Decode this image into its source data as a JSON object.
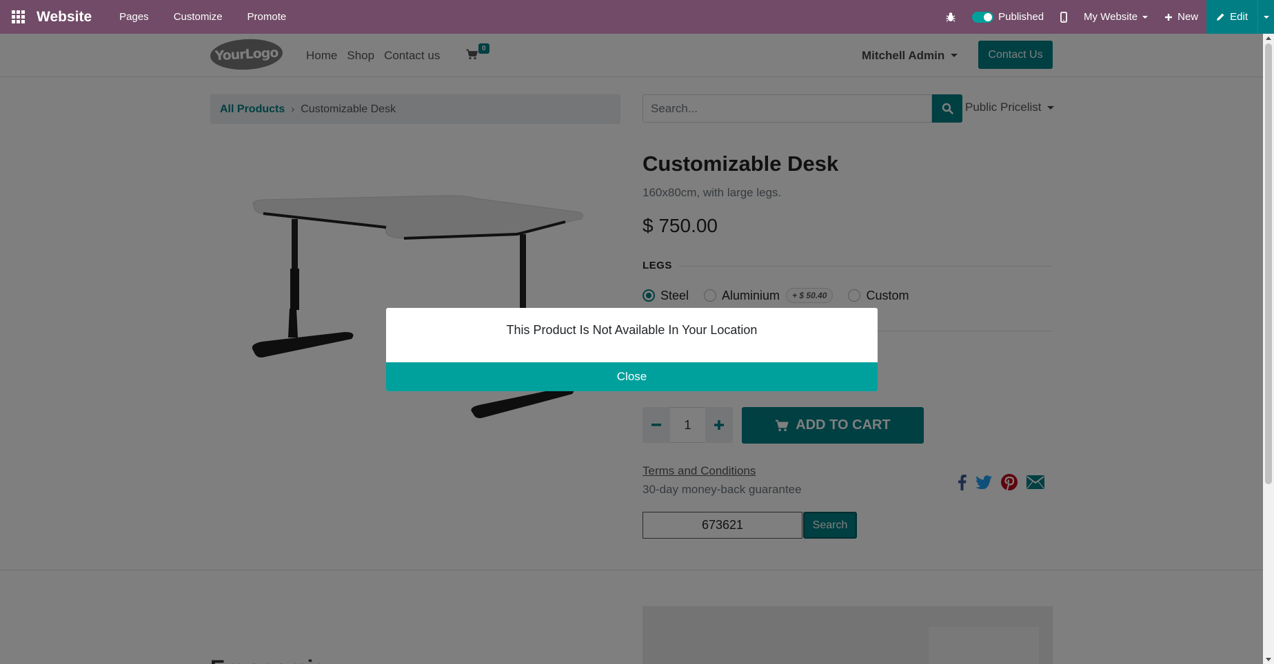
{
  "admin_bar": {
    "brand": "Website",
    "menu": [
      "Pages",
      "Customize",
      "Promote"
    ],
    "published_label": "Published",
    "website_label": "My Website",
    "new_label": "New",
    "edit_label": "Edit",
    "color": "#714b67",
    "edit_color": "#017e84"
  },
  "header": {
    "logo_text": "YourLogo",
    "nav": [
      "Home",
      "Shop",
      "Contact us"
    ],
    "cart_count": "0",
    "user_name": "Mitchell Admin",
    "contact_button": "Contact Us"
  },
  "breadcrumb": {
    "parent": "All Products",
    "current": "Customizable Desk"
  },
  "search": {
    "placeholder": "Search...",
    "pricelist": "Public Pricelist"
  },
  "product": {
    "name": "Customizable Desk",
    "description": "160x80cm, with large legs.",
    "price": "$ 750.00",
    "attribute_label": "LEGS",
    "options": [
      {
        "label": "Steel",
        "selected": true
      },
      {
        "label": "Aluminium",
        "extra": "+ $ 50.40",
        "selected": false
      },
      {
        "label": "Custom",
        "selected": false
      }
    ],
    "quantity": "1",
    "add_to_cart": "ADD TO CART",
    "terms": "Terms and Conditions",
    "guarantee": "30-day money-back guarantee",
    "zip_value": "673621",
    "zip_button": "Search"
  },
  "bottom": {
    "heading": "Ergonomic"
  },
  "modal": {
    "message": "This Product Is Not Available In Your Location",
    "close": "Close"
  },
  "icons": [
    "apps-icon",
    "bug-icon",
    "mobile-icon",
    "plus-icon",
    "pencil-icon",
    "cart-icon",
    "search-icon",
    "facebook-icon",
    "twitter-icon",
    "pinterest-icon",
    "envelope-icon"
  ],
  "colors": {
    "primary": "#017e84",
    "modal_button": "#00a09d",
    "facebook": "#3b5998",
    "twitter": "#1da1f2",
    "pinterest": "#bd081c"
  }
}
